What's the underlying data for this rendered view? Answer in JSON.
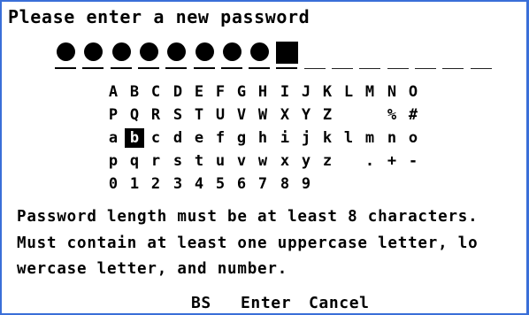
{
  "prompt": "Please enter a new password",
  "password": {
    "entered_count": 8,
    "total_slots": 16
  },
  "keyboard": {
    "rows": [
      [
        "A",
        "B",
        "C",
        "D",
        "E",
        "F",
        "G",
        "H",
        "I",
        "J",
        "K",
        "L",
        "M",
        "N",
        "O"
      ],
      [
        "P",
        "Q",
        "R",
        "S",
        "T",
        "U",
        "V",
        "W",
        "X",
        "Y",
        "Z",
        "",
        "",
        "%",
        "#"
      ],
      [
        "a",
        "b",
        "c",
        "d",
        "e",
        "f",
        "g",
        "h",
        "i",
        "j",
        "k",
        "l",
        "m",
        "n",
        "o"
      ],
      [
        "p",
        "q",
        "r",
        "s",
        "t",
        "u",
        "v",
        "w",
        "x",
        "y",
        "z",
        "",
        ".",
        "+",
        "-"
      ],
      [
        "0",
        "1",
        "2",
        "3",
        "4",
        "5",
        "6",
        "7",
        "8",
        "9",
        "",
        "",
        "",
        "",
        ""
      ]
    ],
    "selected_key": "b"
  },
  "messages": [
    "Password length must be at least 8 characters.",
    "Must contain at least one uppercase letter, lo",
    "wercase letter, and number."
  ],
  "buttons": {
    "backspace": "BS",
    "enter": "Enter",
    "cancel": "Cancel"
  },
  "colors": {
    "border": "#3a6fd8",
    "foreground": "#000000",
    "background": "#ffffff"
  }
}
